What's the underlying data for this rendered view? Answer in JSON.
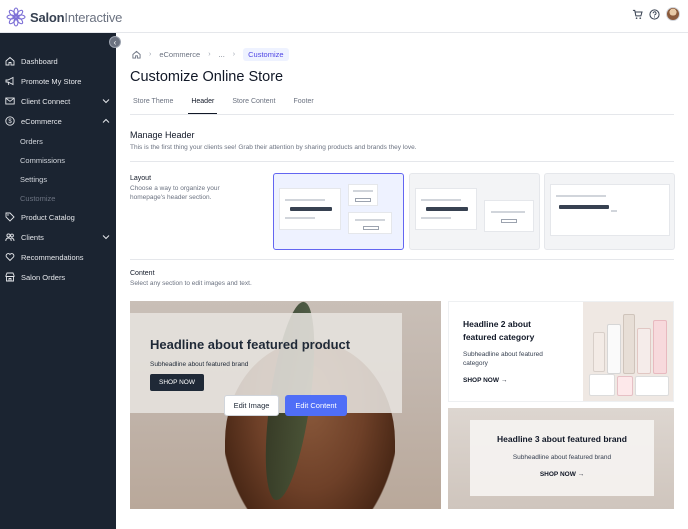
{
  "app": {
    "name_bold": "Salon",
    "name_light": "Interactive"
  },
  "topbar": {
    "icons": [
      "cart-icon",
      "help-icon",
      "avatar"
    ]
  },
  "sidebar": {
    "items": [
      {
        "label": "Dashboard",
        "icon": "home-icon"
      },
      {
        "label": "Promote My Store",
        "icon": "megaphone-icon"
      },
      {
        "label": "Client Connect",
        "icon": "mail-icon",
        "expandable": true
      },
      {
        "label": "eCommerce",
        "icon": "dollar-icon",
        "expanded": true
      },
      {
        "label": "Product Catalog",
        "icon": "tag-icon"
      },
      {
        "label": "Clients",
        "icon": "users-icon",
        "expandable": true
      },
      {
        "label": "Recommendations",
        "icon": "heart-icon"
      },
      {
        "label": "Salon Orders",
        "icon": "store-icon"
      }
    ],
    "ecommerce_sub": [
      "Orders",
      "Commissions",
      "Settings",
      "Customize"
    ],
    "active_sub": "Customize"
  },
  "breadcrumb": {
    "items": [
      "eCommerce",
      "...",
      "Customize"
    ]
  },
  "page": {
    "title": "Customize Online Store",
    "tabs": [
      "Store Theme",
      "Header",
      "Store Content",
      "Footer"
    ],
    "active_tab": "Header"
  },
  "manage_header": {
    "title": "Manage Header",
    "description": "This is the first thing your clients see! Grab their attention by sharing products and brands they love.",
    "layout_label": "Layout",
    "layout_desc": "Choose a way to organize your homepage's header section.",
    "layouts_selected_index": 0,
    "content_label": "Content",
    "content_desc": "Select any section to edit images and text."
  },
  "hero": {
    "headline": "Headline about featured product",
    "sub": "Subheadline about featured brand",
    "shop": "SHOP NOW",
    "edit_image": "Edit Image",
    "edit_content": "Edit Content"
  },
  "card2": {
    "headline": "Headline 2 about featured category",
    "sub": "Subheadline about featured category",
    "shop": "SHOP NOW"
  },
  "card3": {
    "headline": "Headline 3 about featured brand",
    "sub": "Subheadline about featured brand",
    "shop": "SHOP NOW"
  },
  "colors": {
    "sidebar": "#1b2431",
    "accent": "#4f6ef7",
    "selected_border": "#6366f1"
  }
}
